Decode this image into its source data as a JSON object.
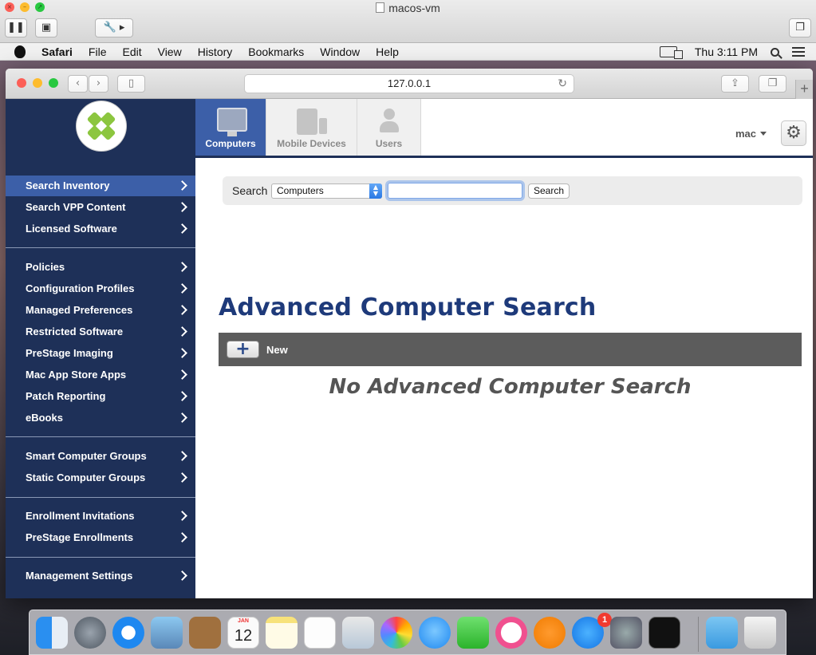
{
  "vm": {
    "title": "macos-vm"
  },
  "menubar": {
    "app": "Safari",
    "items": [
      "File",
      "Edit",
      "View",
      "History",
      "Bookmarks",
      "Window",
      "Help"
    ],
    "clock": "Thu 3:11 PM"
  },
  "browser": {
    "url": "127.0.0.1"
  },
  "tabs": [
    {
      "label": "Computers",
      "active": true
    },
    {
      "label": "Mobile Devices",
      "active": false
    },
    {
      "label": "Users",
      "active": false
    }
  ],
  "user_menu": {
    "label": "mac"
  },
  "sidebar": {
    "items": [
      "Search Inventory",
      "Search VPP Content",
      "Licensed Software",
      "Policies",
      "Configuration Profiles",
      "Managed Preferences",
      "Restricted Software",
      "PreStage Imaging",
      "Mac App Store Apps",
      "Patch Reporting",
      "eBooks",
      "Smart Computer Groups",
      "Static Computer Groups",
      "Enrollment Invitations",
      "PreStage Enrollments",
      "Management Settings"
    ],
    "active_item": "Search Inventory"
  },
  "search": {
    "label": "Search",
    "select_value": "Computers",
    "input_value": "",
    "button_label": "Search"
  },
  "main": {
    "title": "Advanced Computer Search",
    "new_label": "New",
    "empty_message": "No Advanced Computer Search"
  },
  "dock": {
    "calendar_month": "JAN",
    "calendar_day": "12",
    "app_store_badge": "1"
  },
  "colors": {
    "sidebar_bg": "#1e3058",
    "accent_blue": "#3c5fa8",
    "title_blue": "#1e3a7a",
    "toolbar_gray": "#5c5c5c",
    "logo_green": "#8cc63f"
  }
}
